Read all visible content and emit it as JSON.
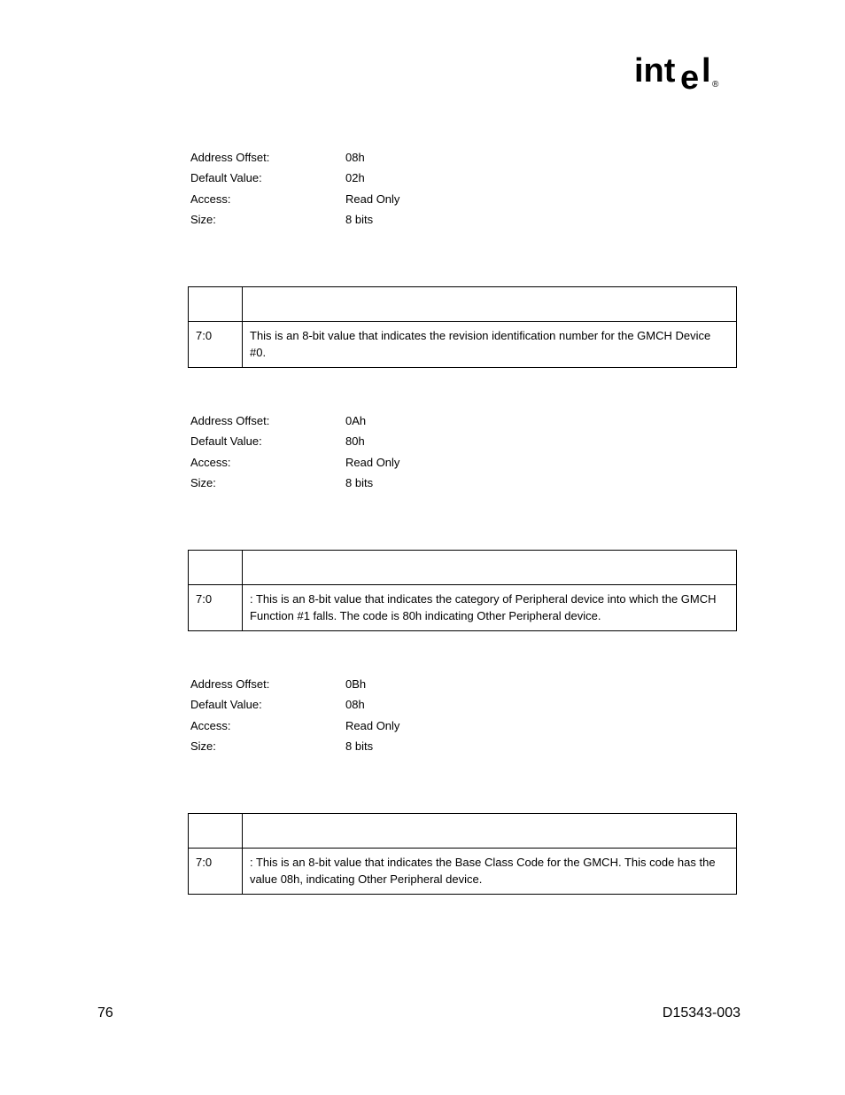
{
  "logo_text": "intel",
  "sections": [
    {
      "props": [
        {
          "label": "Address Offset:",
          "value": "08h"
        },
        {
          "label": "Default Value:",
          "value": "02h"
        },
        {
          "label": "Access:",
          "value": "Read Only"
        },
        {
          "label": "Size:",
          "value": "8 bits"
        }
      ],
      "header_bit": "",
      "header_desc": "",
      "row_bit": "7:0",
      "row_desc_lead": "",
      "row_desc_tail": "This is an 8-bit value that indicates the revision identification number for the GMCH Device #0."
    },
    {
      "props": [
        {
          "label": "Address Offset:",
          "value": "0Ah"
        },
        {
          "label": "Default Value:",
          "value": "80h"
        },
        {
          "label": "Access:",
          "value": "Read Only"
        },
        {
          "label": "Size:",
          "value": "8 bits"
        }
      ],
      "header_bit": "",
      "header_desc": "",
      "row_bit": "7:0",
      "row_desc_lead": "",
      "row_desc_tail": ": This is an 8-bit value that indicates the category of Peripheral device into which the GMCH Function #1 falls. The code is 80h indicating Other Peripheral device."
    },
    {
      "props": [
        {
          "label": "Address Offset:",
          "value": "0Bh"
        },
        {
          "label": "Default Value:",
          "value": "08h"
        },
        {
          "label": "Access:",
          "value": "Read Only"
        },
        {
          "label": "Size:",
          "value": "8 bits"
        }
      ],
      "header_bit": "",
      "header_desc": "",
      "row_bit": "7:0",
      "row_desc_lead": "",
      "row_desc_tail": ": This is an 8-bit value that indicates the Base Class Code for the GMCH. This code has the value 08h, indicating Other Peripheral device."
    }
  ],
  "footer": {
    "page_number": "76",
    "doc_id": "D15343-003"
  }
}
